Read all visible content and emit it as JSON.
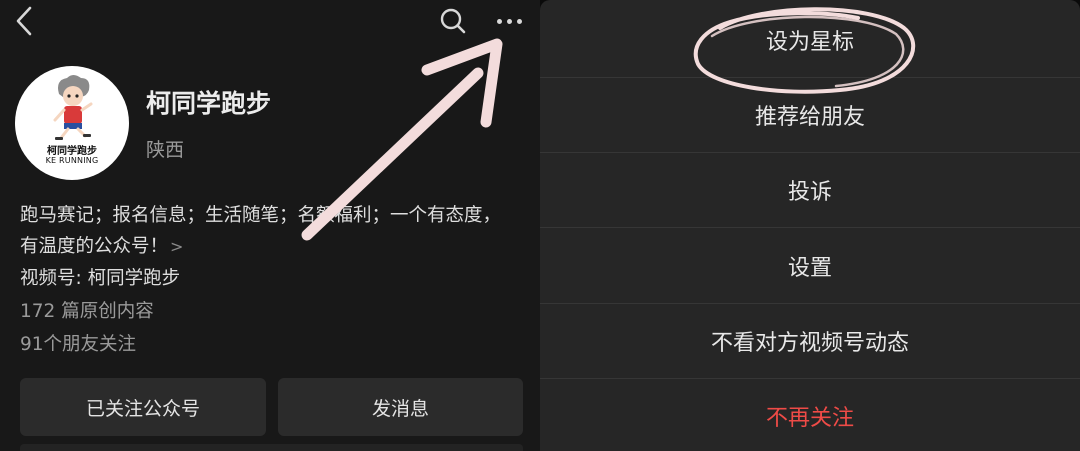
{
  "profile": {
    "account_name": "柯同学跑步",
    "region": "陕西",
    "avatar_text_cn": "柯同学跑步",
    "avatar_text_en": "KE RUNNING",
    "description": "跑马赛记；报名信息；生活随笔；名额福利；一个有态度，有温度的公众号！",
    "description_chevron": ">",
    "channel": "视频号: 柯同学跑步",
    "original_count": "172 篇原创内容",
    "friends_following": "91个朋友关注",
    "followed_button": "已关注公众号",
    "message_button": "发消息"
  },
  "menu": {
    "items": [
      {
        "label": "设为星标"
      },
      {
        "label": "推荐给朋友"
      },
      {
        "label": "投诉"
      },
      {
        "label": "设置"
      },
      {
        "label": "不看对方视频号动态"
      },
      {
        "label": "不再关注"
      }
    ]
  },
  "icons": {
    "back": "back-icon",
    "search": "search-icon",
    "more": "more-icon"
  },
  "colors": {
    "danger": "#ef4b47",
    "annotation": "#f3dcdc"
  }
}
